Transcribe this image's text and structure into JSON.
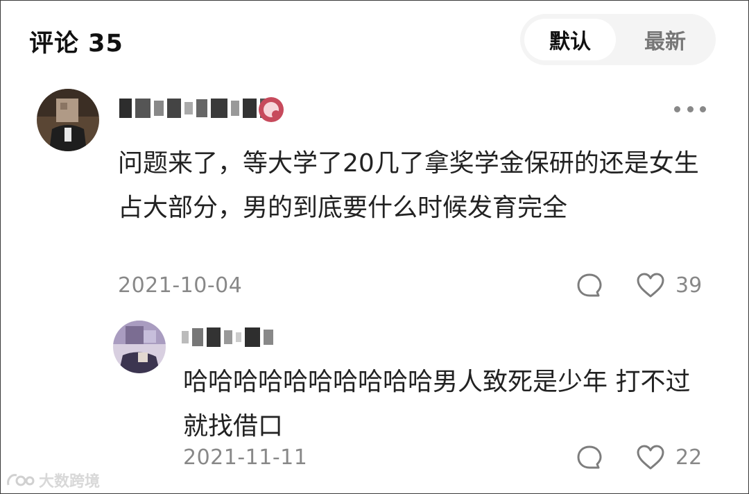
{
  "header": {
    "title": "评论 35"
  },
  "sort": {
    "default_label": "默认",
    "latest_label": "最新"
  },
  "comments": [
    {
      "text": "问题来了，等大学了20几了拿奖学金保研的还是女生占大部分，男的到底要什么时候发育完全",
      "timestamp": "2021-10-04",
      "likes": "39"
    }
  ],
  "replies": [
    {
      "text": "哈哈哈哈哈哈哈哈哈哈男人致死是少年 打不过就找借口",
      "timestamp": "2021-11-11",
      "likes": "22"
    }
  ],
  "watermark": {
    "text": "大数跨境"
  },
  "icons": {
    "comment": "speech-bubble-icon",
    "like": "heart-icon",
    "more": "more-dots-icon",
    "badge": "level-badge-icon"
  },
  "colors": {
    "badge": "#c74a5c",
    "muted": "#888888",
    "text": "#222222"
  }
}
